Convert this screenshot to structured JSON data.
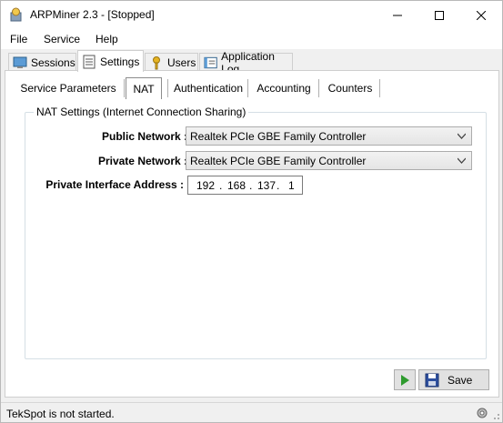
{
  "window": {
    "title": "ARPMiner 2.3 - [Stopped]"
  },
  "menu": {
    "items": [
      "File",
      "Service",
      "Help"
    ]
  },
  "top_tabs": [
    {
      "label": "Sessions",
      "icon": "sessions-icon"
    },
    {
      "label": "Settings",
      "icon": "settings-icon",
      "active": true
    },
    {
      "label": "Users",
      "icon": "users-key-icon"
    },
    {
      "label": "Application Log",
      "icon": "log-icon"
    }
  ],
  "sub_tabs": [
    {
      "label": "Service Parameters"
    },
    {
      "label": "NAT",
      "active": true
    },
    {
      "label": "Authentication"
    },
    {
      "label": "Accounting"
    },
    {
      "label": "Counters"
    }
  ],
  "nat": {
    "group_title": "NAT Settings (Internet Connection Sharing)",
    "public_label": "Public Network :",
    "public_value": "Realtek PCIe GBE Family Controller",
    "private_label": "Private Network :",
    "private_value": "Realtek PCIe GBE Family Controller",
    "address_label": "Private Interface Address :",
    "ip": [
      "192",
      "168",
      "137",
      "1"
    ],
    "ip_dot": "."
  },
  "buttons": {
    "save_label": "Save"
  },
  "status": {
    "text": "TekSpot is not started."
  },
  "colors": {
    "accent": "#1a73c8",
    "play_green": "#2e9b2e"
  }
}
